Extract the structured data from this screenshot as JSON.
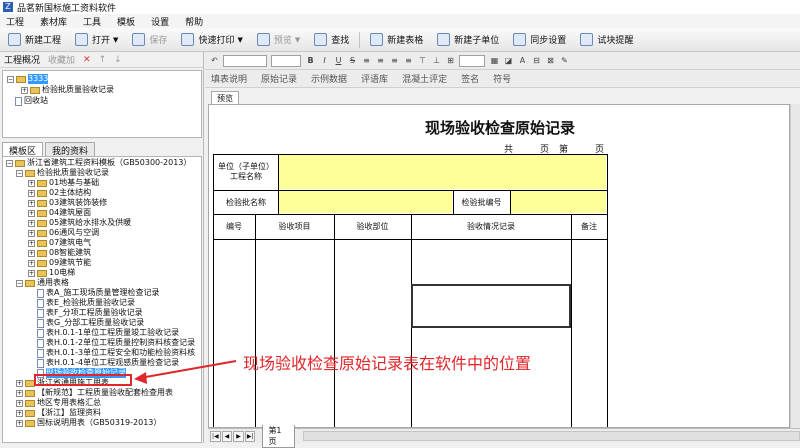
{
  "window": {
    "title": "品茗新国标施工资料软件",
    "app_icon": "Z"
  },
  "menu": [
    "工程",
    "素材库",
    "工具",
    "模板",
    "设置",
    "帮助"
  ],
  "toolbar": {
    "new_project": "新建工程",
    "open": "打开",
    "save": "保存",
    "quick_print": "快速打印",
    "preview": "预览",
    "search": "查找",
    "new_table": "新建表格",
    "new_subunit": "新建子单位",
    "sync_settings": "同步设置",
    "test_reminder": "试块提醒"
  },
  "left_panel": {
    "toolbar": {
      "overview": "工程概况",
      "favorites": "收藏加"
    },
    "project_tree": [
      {
        "label": "3333",
        "level": 0,
        "selected": true
      },
      {
        "label": "检验批质量验收记录",
        "level": 1
      },
      {
        "label": "回收站",
        "level": 0
      }
    ],
    "tabs": [
      "模板区",
      "我的资料"
    ],
    "template_tree": [
      {
        "label": "浙江省建筑工程资料模板（GB50300-2013）",
        "level": 0,
        "type": "folder"
      },
      {
        "label": "检验批质量验收记录",
        "level": 1,
        "type": "folder"
      },
      {
        "label": "01地基与基础",
        "level": 2,
        "type": "folder"
      },
      {
        "label": "02主体结构",
        "level": 2,
        "type": "folder"
      },
      {
        "label": "03建筑装饰装修",
        "level": 2,
        "type": "folder"
      },
      {
        "label": "04建筑屋面",
        "level": 2,
        "type": "folder"
      },
      {
        "label": "05建筑给水排水及供暖",
        "level": 2,
        "type": "folder"
      },
      {
        "label": "06通风与空调",
        "level": 2,
        "type": "folder"
      },
      {
        "label": "07建筑电气",
        "level": 2,
        "type": "folder"
      },
      {
        "label": "08智能建筑",
        "level": 2,
        "type": "folder"
      },
      {
        "label": "09建筑节能",
        "level": 2,
        "type": "folder"
      },
      {
        "label": "10电梯",
        "level": 2,
        "type": "folder"
      },
      {
        "label": "通用表格",
        "level": 1,
        "type": "folder"
      },
      {
        "label": "表A_施工现场质量管理检查记录",
        "level": 2,
        "type": "doc"
      },
      {
        "label": "表E_检验批质量验收记录",
        "level": 2,
        "type": "doc"
      },
      {
        "label": "表F_分项工程质量验收记录",
        "level": 2,
        "type": "doc"
      },
      {
        "label": "表G_分部工程质量验收记录",
        "level": 2,
        "type": "doc"
      },
      {
        "label": "表H.0.1-1单位工程质量竣工验收记录",
        "level": 2,
        "type": "doc"
      },
      {
        "label": "表H.0.1-2单位工程质量控制资料核查记录",
        "level": 2,
        "type": "doc"
      },
      {
        "label": "表H.0.1-3单位工程安全和功能检验资料核",
        "level": 2,
        "type": "doc"
      },
      {
        "label": "表H.0.1-4单位工程观感质量检查记录",
        "level": 2,
        "type": "doc"
      },
      {
        "label": "现场验收检查原始记录",
        "level": 2,
        "type": "doc",
        "selected": true
      },
      {
        "label": "浙江省通用施工用表",
        "level": 1,
        "type": "folder"
      },
      {
        "label": "【新规范】工程质量验收配套检查用表",
        "level": 1,
        "type": "folder"
      },
      {
        "label": "地区专用表格汇总",
        "level": 1,
        "type": "folder"
      },
      {
        "label": "【浙江】监理资料",
        "level": 1,
        "type": "folder"
      },
      {
        "label": "国标说明用表（GB50319-2013）",
        "level": 1,
        "type": "folder"
      }
    ]
  },
  "format_bar": {
    "buttons": [
      "填表说明",
      "原始记录",
      "示例数据",
      "评语库",
      "混凝土评定",
      "签名",
      "符号"
    ]
  },
  "document": {
    "tab": "预览",
    "title": "现场验收检查原始记录",
    "page_total_label": "共",
    "page_total_suffix": "页",
    "page_current_label": "第",
    "page_current_suffix": "页",
    "unit_name_label": "单位（子单位）工程名称",
    "batch_name_label": "检验批名称",
    "batch_no_label": "检验批编号",
    "columns": [
      "编号",
      "验收项目",
      "验收部位",
      "验收情况记录",
      "备注"
    ]
  },
  "sheet_tab": "第1页",
  "annotation": "现场验收检查原始记录表在软件中的位置",
  "colors": {
    "highlight_yellow": "#ffff99",
    "annotation_red": "#e0262a",
    "selection_blue": "#3399ff"
  }
}
